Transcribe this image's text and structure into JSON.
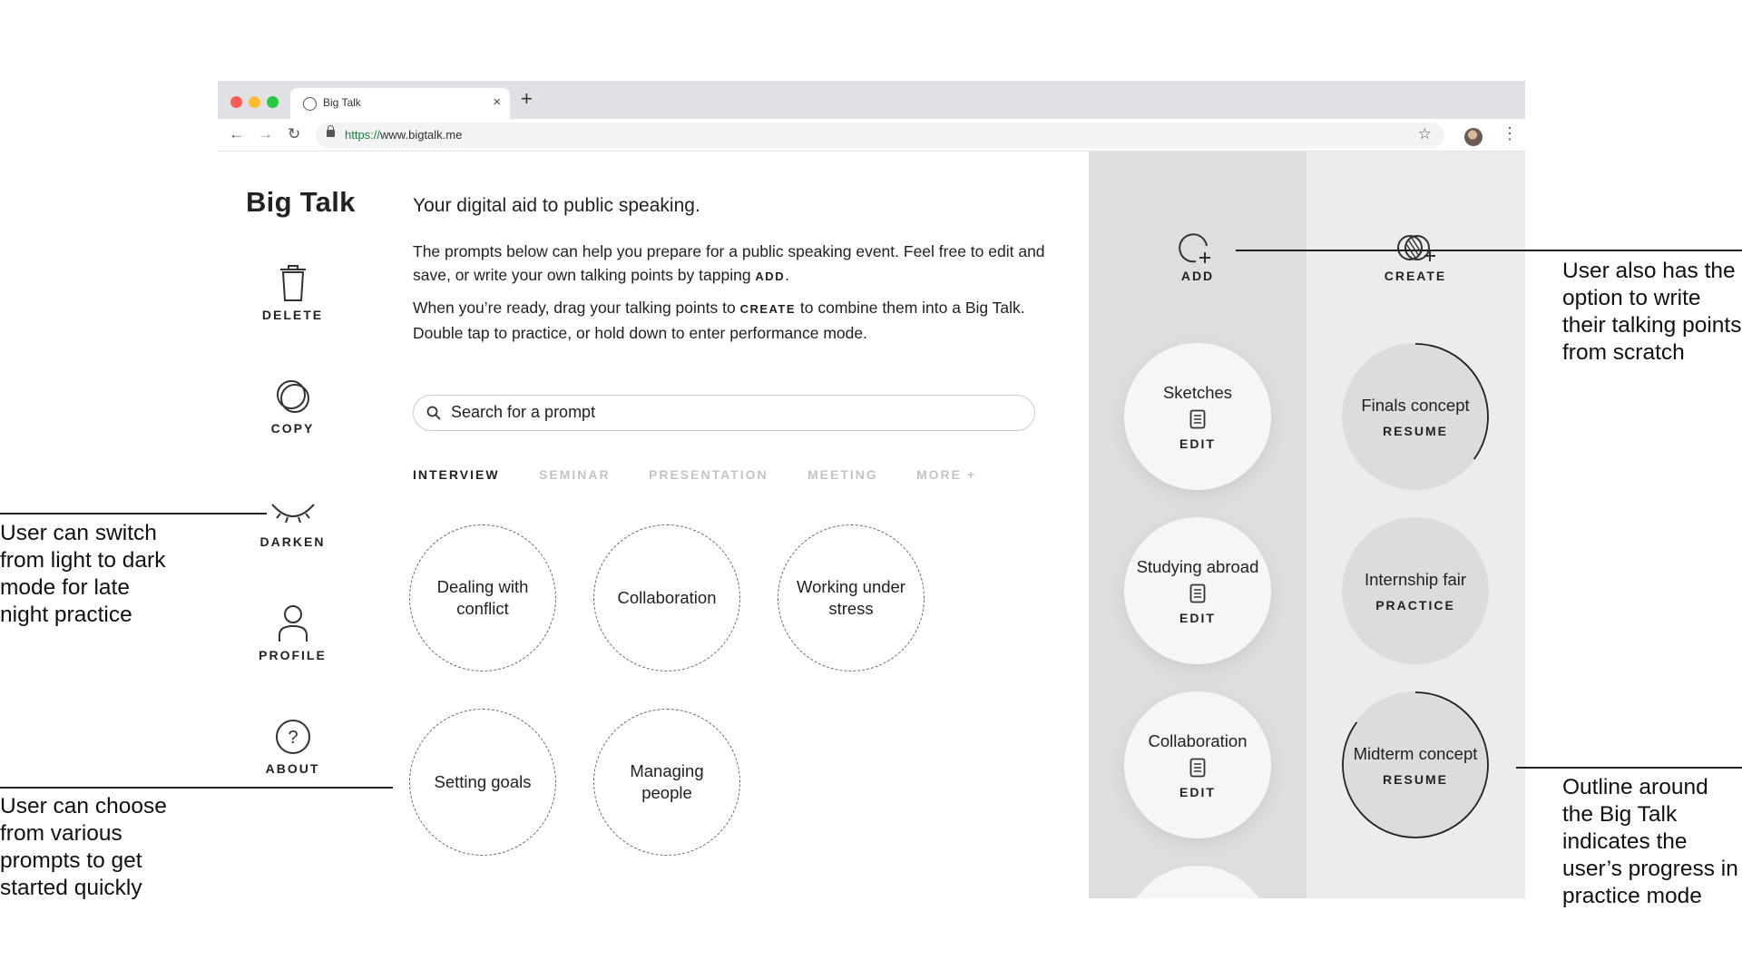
{
  "browser": {
    "tab_title": "Big Talk",
    "tab_close": "×",
    "new_tab": "+",
    "back": "←",
    "forward": "→",
    "reload": "↻",
    "url_scheme": "https://",
    "url_rest": "www.bigtalk.me",
    "star": "☆",
    "menu": "⋮"
  },
  "app": {
    "brand": "Big Talk",
    "sidebar": [
      {
        "label": "DELETE",
        "icon": "trash-icon"
      },
      {
        "label": "COPY",
        "icon": "copy-icon"
      },
      {
        "label": "DARKEN",
        "icon": "eye-closed-icon"
      },
      {
        "label": "PROFILE",
        "icon": "person-icon"
      },
      {
        "label": "ABOUT",
        "icon": "question-icon"
      }
    ],
    "tagline": "Your digital aid to public speaking.",
    "intro1_pre": "The prompts below can help you prepare for a public speaking event. Feel free to edit and save, or write your own talking points by tapping ",
    "intro1_key": "ADD",
    "intro1_post": ".",
    "intro2_pre": "When you’re ready, drag your talking points to ",
    "intro2_key": "CREATE",
    "intro2_post": " to combine them into a Big Talk. Double tap to practice, or hold down to enter performance mode.",
    "search_placeholder": "Search for a prompt",
    "categories": [
      "INTERVIEW",
      "SEMINAR",
      "PRESENTATION",
      "MEETING",
      "MORE +"
    ],
    "prompts": [
      "Dealing with conflict",
      "Collaboration",
      "Working under stress",
      "Setting goals",
      "Managing people"
    ],
    "add_label": "ADD",
    "create_label": "CREATE",
    "talking_points": [
      {
        "title": "Sketches",
        "action": "EDIT"
      },
      {
        "title": "Studying abroad",
        "action": "EDIT"
      },
      {
        "title": "Collaboration",
        "action": "EDIT"
      }
    ],
    "big_talks": [
      {
        "title": "Finals concept",
        "action": "RESUME",
        "progress": 0.35
      },
      {
        "title": "Internship fair",
        "action": "PRACTICE",
        "progress": 0
      },
      {
        "title": "Midterm concept",
        "action": "RESUME",
        "progress": 0.85
      }
    ]
  },
  "annotations": {
    "create": "User also has the option to write their talking points from scratch",
    "darken": "User can switch from light to dark mode for late night practice",
    "prompts": "User can choose from various prompts to get started quickly",
    "outline": "Outline around the Big Talk indicates the user’s progress in practice mode"
  }
}
